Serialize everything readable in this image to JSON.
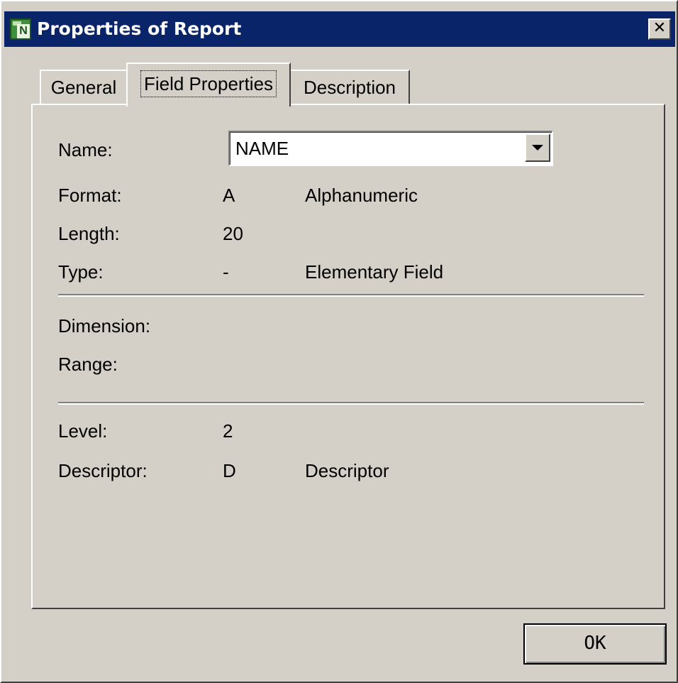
{
  "window": {
    "title": "Properties of Report",
    "icon_letter": "N",
    "close_glyph": "✕"
  },
  "tabs": [
    {
      "label": "General",
      "active": false
    },
    {
      "label": "Field Properties",
      "active": true
    },
    {
      "label": "Description",
      "active": false
    }
  ],
  "fields": {
    "name": {
      "label": "Name:",
      "value": "NAME"
    },
    "format": {
      "label": "Format:",
      "code": "A",
      "description": "Alphanumeric"
    },
    "length": {
      "label": "Length:",
      "value": "20"
    },
    "type": {
      "label": "Type:",
      "code": "-",
      "description": "Elementary Field"
    },
    "dimension": {
      "label": "Dimension:"
    },
    "range": {
      "label": "Range:"
    },
    "level": {
      "label": "Level:",
      "value": "2"
    },
    "descriptor": {
      "label": "Descriptor:",
      "code": "D",
      "description": "Descriptor"
    }
  },
  "buttons": {
    "ok": "OK"
  },
  "icons": {
    "app": "natural-app-icon",
    "close": "close-icon",
    "dropdown": "chevron-down-icon"
  },
  "colors": {
    "titlebar": "#0a246a",
    "face": "#d4d0c8",
    "title_text": "#ffffff"
  }
}
